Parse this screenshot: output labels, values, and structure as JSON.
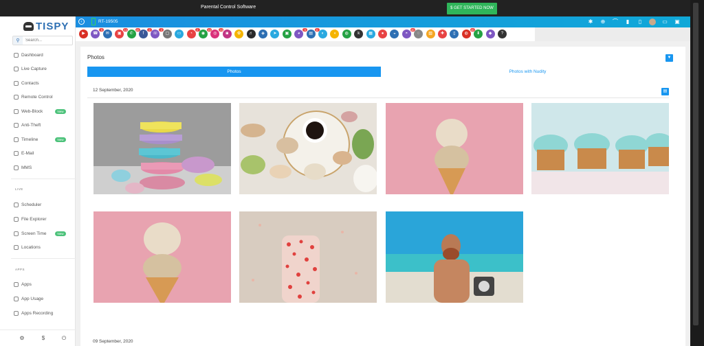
{
  "banner": {
    "title": "Parental Control Software",
    "cta": "GET STARTED NOW"
  },
  "sidebar": {
    "brand": "TISPY",
    "search_placeholder": "Search...",
    "items": [
      {
        "label": "Dashboard"
      },
      {
        "label": "Live Capture"
      },
      {
        "label": "Contacts"
      },
      {
        "label": "Remote Control"
      },
      {
        "label": "Web-Block",
        "badge": "New"
      },
      {
        "label": "Anti-Theft"
      },
      {
        "label": "Timeline",
        "badge": "New"
      },
      {
        "label": "E-Mail"
      },
      {
        "label": "MMS"
      }
    ],
    "section_live": "LIVE",
    "live_items": [
      {
        "label": "Scheduler"
      },
      {
        "label": "File Explorer"
      },
      {
        "label": "Screen Time",
        "badge": "New"
      },
      {
        "label": "Locations"
      }
    ],
    "section_apps": "APPS",
    "app_items": [
      {
        "label": "Apps"
      },
      {
        "label": "App Usage"
      },
      {
        "label": "Apps Recording"
      }
    ],
    "footer": {
      "settings": "⚙",
      "billing": "$",
      "logout": "⏻"
    }
  },
  "device": {
    "name": "RT-19505"
  },
  "apps": [
    {
      "color": "#d93025",
      "glyph": "▶"
    },
    {
      "color": "#7e57c2",
      "glyph": "☎",
      "count": "5"
    },
    {
      "color": "#2d6fb3",
      "glyph": "✉"
    },
    {
      "color": "#e84343",
      "glyph": "▣",
      "count": "14"
    },
    {
      "color": "#25a244",
      "glyph": "✆",
      "count": "40"
    },
    {
      "color": "#3b5998",
      "glyph": "f",
      "count": "2"
    },
    {
      "color": "#7e57c2",
      "glyph": "☏",
      "count": "2"
    },
    {
      "color": "#777777",
      "glyph": "▢"
    },
    {
      "color": "#29a9e0",
      "glyph": "▭"
    },
    {
      "color": "#e84343",
      "glyph": "◔",
      "count": "2"
    },
    {
      "color": "#25a244",
      "glyph": "◉",
      "count": "10"
    },
    {
      "color": "#d9317a",
      "glyph": "◎",
      "count": "10"
    },
    {
      "color": "#c13584",
      "glyph": "◙"
    },
    {
      "color": "#f5b400",
      "glyph": "✿"
    },
    {
      "color": "#2a2a2a",
      "glyph": "♬"
    },
    {
      "color": "#2d6fb3",
      "glyph": "◈"
    },
    {
      "color": "#29a9e0",
      "glyph": "➤"
    },
    {
      "color": "#25a244",
      "glyph": "▣"
    },
    {
      "color": "#7e57c2",
      "glyph": "◕",
      "count": "5"
    },
    {
      "color": "#2d6fb3",
      "glyph": "▤",
      "count": "6"
    },
    {
      "color": "#29a9e0",
      "glyph": "◐"
    },
    {
      "color": "#f5b400",
      "glyph": "◖"
    },
    {
      "color": "#25a244",
      "glyph": "◍"
    },
    {
      "color": "#333333",
      "glyph": "k"
    },
    {
      "color": "#29a9e0",
      "glyph": "▦"
    },
    {
      "color": "#e84343",
      "glyph": "●"
    },
    {
      "color": "#2d6fb3",
      "glyph": "◒"
    },
    {
      "color": "#7e57c2",
      "glyph": "◓",
      "count": "40"
    },
    {
      "color": "#888888",
      "glyph": "◌"
    },
    {
      "color": "#f5a623",
      "glyph": "▧"
    },
    {
      "color": "#e84343",
      "glyph": "✚"
    },
    {
      "color": "#2d6fb3",
      "glyph": "▯"
    },
    {
      "color": "#d93025",
      "glyph": "◍",
      "count": "40"
    },
    {
      "color": "#25a244",
      "glyph": "⬇"
    },
    {
      "color": "#7e57c2",
      "glyph": "◆"
    },
    {
      "color": "#333333",
      "glyph": "?"
    }
  ],
  "content": {
    "title": "Photos",
    "tabs": [
      {
        "label": "Photos"
      },
      {
        "label": "Photos with Nudity"
      }
    ],
    "groups": [
      {
        "date": "12 September, 2020"
      },
      {
        "date": "09 September, 2020"
      }
    ]
  },
  "photos": [
    {
      "subject": "macarons"
    },
    {
      "subject": "coffee-macarons"
    },
    {
      "subject": "ice-cream-cone"
    },
    {
      "subject": "cupcakes"
    },
    {
      "subject": "ice-cream-cone"
    },
    {
      "subject": "sprinkle-bar"
    },
    {
      "subject": "beach-man"
    }
  ]
}
